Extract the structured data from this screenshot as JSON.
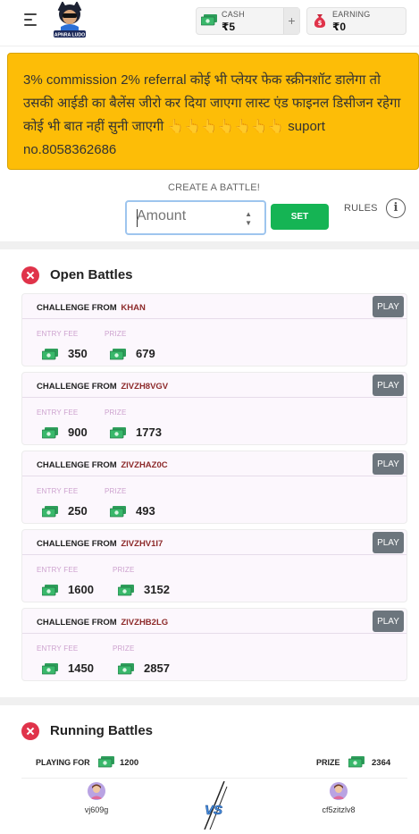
{
  "header": {
    "logo_text": "APNRA LUDO",
    "cash": {
      "label": "CASH",
      "value": "₹5",
      "add": "+"
    },
    "earning": {
      "label": "EARNING",
      "value": "₹0"
    }
  },
  "notice": "3% commission 2% referral कोई भी प्लेयर फेक स्क्रीनशॉट डालेगा तो उसकी आईडी का बैलेंस जीरो कर दिया जाएगा लास्ट एंड फाइनल डिसीजन रहेगा कोई भी बात नहीं सुनी जाएगी 👆👆👆👆👆👆👆 suport no.8058362686",
  "create": {
    "label": "CREATE A BATTLE!",
    "placeholder": "Amount",
    "set_label": "SET",
    "rules_label": "RULES",
    "info_glyph": "i"
  },
  "open_battles": {
    "title": "Open Battles",
    "challenge_prefix": "CHALLENGE FROM",
    "entry_label": "ENTRY FEE",
    "prize_label": "PRIZE",
    "play_label": "PLAY",
    "items": [
      {
        "name": "KHAN",
        "entry": "350",
        "prize": "679"
      },
      {
        "name": "ZIVZH8VGV",
        "entry": "900",
        "prize": "1773"
      },
      {
        "name": "ZIVZHAZ0C",
        "entry": "250",
        "prize": "493"
      },
      {
        "name": "ZIVZHV1I7",
        "entry": "1600",
        "prize": "3152"
      },
      {
        "name": "ZIVZHB2LG",
        "entry": "1450",
        "prize": "2857"
      }
    ]
  },
  "running_battles": {
    "title": "Running Battles",
    "playing_for_label": "PLAYING FOR",
    "playing_for_value": "1200",
    "prize_label": "PRIZE",
    "prize_value": "2364",
    "player1": "vj609g",
    "player2": "cf5zitzlv8"
  },
  "colors": {
    "accent_green": "#15b454",
    "notice_bg": "#fdbd07",
    "danger": "#e0334a",
    "play_btn": "#6c757d"
  }
}
